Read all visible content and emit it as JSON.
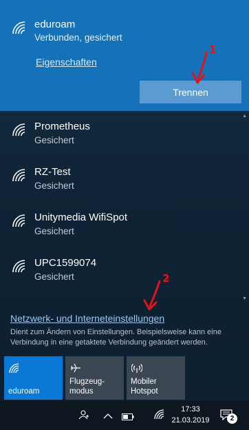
{
  "connected_network": {
    "name": "eduroam",
    "status": "Verbunden, gesichert",
    "properties_link": "Eigenschaften",
    "disconnect_button": "Trennen"
  },
  "annotations": {
    "one": "1",
    "two": "2",
    "color": "#e0141b"
  },
  "networks": [
    {
      "name": "Prometheus",
      "status": "Gesichert"
    },
    {
      "name": "RZ-Test",
      "status": "Gesichert"
    },
    {
      "name": "Unitymedia WifiSpot",
      "status": "Gesichert"
    },
    {
      "name": "UPC1599074",
      "status": "Gesichert"
    }
  ],
  "settings": {
    "link": "Netzwerk- und Interneteinstellungen",
    "description": "Dient zum Ändern von Einstellungen. Beispielsweise kann eine Verbindung in eine getaktete Verbindung geändert werden."
  },
  "quick_actions": [
    {
      "label": "eduroam",
      "icon": "wifi-icon",
      "active": true
    },
    {
      "label": "Flugzeug-\nmodus",
      "icon": "airplane-icon",
      "active": false
    },
    {
      "label": "Mobiler\nHotspot",
      "icon": "hotspot-icon",
      "active": false
    }
  ],
  "taskbar": {
    "time": "17:33",
    "date": "21.03.2019",
    "notification_count": "2"
  },
  "colors": {
    "accent": "#1572b8",
    "button": "#5b9bd1",
    "active_tile": "#0a78d7"
  }
}
